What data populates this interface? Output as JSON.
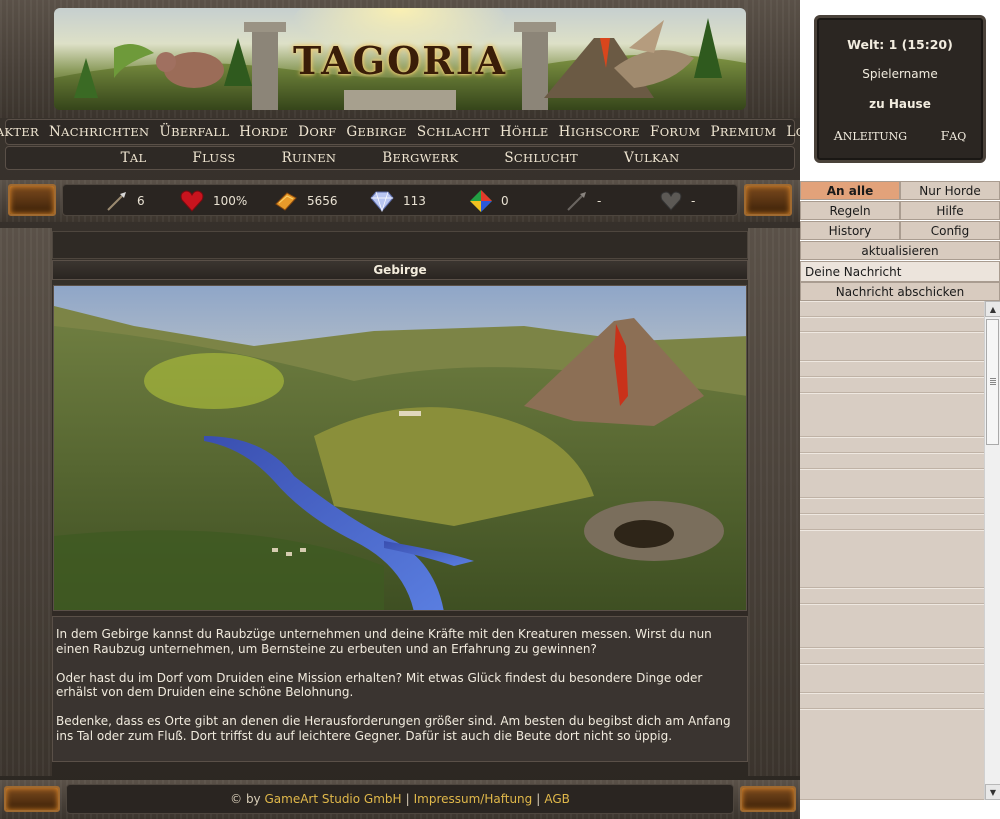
{
  "banner": {
    "title": "TAGORIA"
  },
  "nav_primary": [
    "Charakter",
    "Nachrichten",
    "Überfall",
    "Horde",
    "Dorf",
    "Gebirge",
    "Schlacht",
    "Höhle",
    "Highscore",
    "Forum",
    "Premium",
    "Logout"
  ],
  "nav_secondary": [
    "Tal",
    "Fluss",
    "Ruinen",
    "Bergwerk",
    "Schlucht",
    "Vulkan"
  ],
  "resources": {
    "weapon": "6",
    "health": "100%",
    "gold": "5656",
    "gems": "113",
    "mana": "0",
    "arrow": "-",
    "stone_heart": "-"
  },
  "page": {
    "title": "Gebirge",
    "paragraphs": [
      "In dem Gebirge kannst du Raubzüge unternehmen und deine Kräfte mit den Kreaturen messen. Wirst du nun einen Raubzug unternehmen, um Bernsteine zu erbeuten und an Erfahrung zu gewinnen?",
      "Oder hast du im Dorf vom Druiden eine Mission erhalten? Mit etwas Glück findest du besondere Dinge oder erhälst von dem Druiden eine schöne Belohnung.",
      "Bedenke, dass es Orte gibt an denen die Herausforderungen größer sind. Am besten du begibst dich am Anfang ins Tal oder zum Fluß. Dort triffst du auf leichtere Gegner. Dafür ist auch die Beute dort nicht so üppig."
    ]
  },
  "footer": {
    "prefix": "© by",
    "company": "GameArt Studio GmbH",
    "sep": "|",
    "impressum": "Impressum/Haftung",
    "agb": "AGB"
  },
  "info": {
    "world": "Welt: 1 (15:20)",
    "player": "Spielername",
    "home": "zu Hause",
    "guide": "Anleitung",
    "faq": "FAQ"
  },
  "chat": {
    "tab_all": "An alle",
    "tab_horde": "Nur Horde",
    "rules": "Regeln",
    "help": "Hilfe",
    "history": "History",
    "config": "Config",
    "refresh": "aktualisieren",
    "message_value": "Deine Nachricht",
    "send": "Nachricht abschicken"
  },
  "colors": {
    "accent_tab": "#e2a27a",
    "link_gold": "#e0b84a",
    "dark_bg": "#2b2622"
  }
}
